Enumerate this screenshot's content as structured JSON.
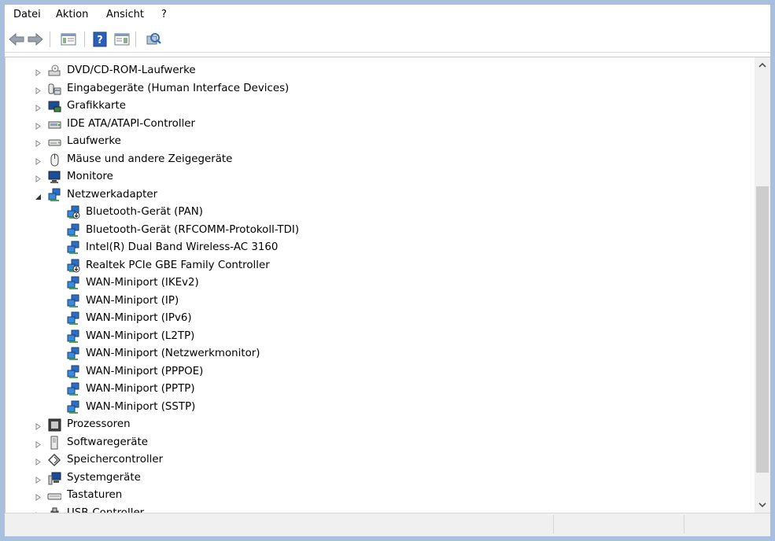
{
  "menu": [
    {
      "label": "Datei",
      "name": "menu-datei"
    },
    {
      "label": "Aktion",
      "name": "menu-aktion"
    },
    {
      "label": "Ansicht",
      "name": "menu-ansicht"
    },
    {
      "label": "?",
      "name": "menu-help"
    }
  ],
  "toolbar": {
    "back_icon": "arrow-left-icon",
    "forward_icon": "arrow-right-icon",
    "console_tree_icon": "console-tree-icon",
    "help_icon": "help-icon",
    "properties_icon": "properties-pane-icon",
    "scan_icon": "scan-hardware-icon"
  },
  "tree": [
    {
      "label": "DVD/CD-ROM-Laufwerke",
      "icon": "dvd-drive-icon",
      "level": 0,
      "expander": "collapsed"
    },
    {
      "label": "Eingabegeräte (Human Interface Devices)",
      "icon": "hid-icon",
      "level": 0,
      "expander": "collapsed"
    },
    {
      "label": "Grafikkarte",
      "icon": "display-adapter-icon",
      "level": 0,
      "expander": "collapsed"
    },
    {
      "label": "IDE ATA/ATAPI-Controller",
      "icon": "ide-controller-icon",
      "level": 0,
      "expander": "collapsed"
    },
    {
      "label": "Laufwerke",
      "icon": "disk-drive-icon",
      "level": 0,
      "expander": "collapsed"
    },
    {
      "label": "Mäuse und andere Zeigegeräte",
      "icon": "mouse-icon",
      "level": 0,
      "expander": "collapsed"
    },
    {
      "label": "Monitore",
      "icon": "monitor-icon",
      "level": 0,
      "expander": "collapsed"
    },
    {
      "label": "Netzwerkadapter",
      "icon": "network-adapter-icon",
      "level": 0,
      "expander": "expanded"
    },
    {
      "label": "Bluetooth-Gerät (PAN)",
      "icon": "network-adapter-down-icon",
      "level": 1,
      "expander": "none"
    },
    {
      "label": "Bluetooth-Gerät (RFCOMM-Protokoll-TDI)",
      "icon": "network-adapter-icon",
      "level": 1,
      "expander": "none"
    },
    {
      "label": "Intel(R) Dual Band Wireless-AC 3160",
      "icon": "network-adapter-icon",
      "level": 1,
      "expander": "none"
    },
    {
      "label": "Realtek PCIe GBE Family Controller",
      "icon": "network-adapter-down-icon",
      "level": 1,
      "expander": "none"
    },
    {
      "label": "WAN-Miniport (IKEv2)",
      "icon": "network-adapter-icon",
      "level": 1,
      "expander": "none"
    },
    {
      "label": "WAN-Miniport (IP)",
      "icon": "network-adapter-icon",
      "level": 1,
      "expander": "none"
    },
    {
      "label": "WAN-Miniport (IPv6)",
      "icon": "network-adapter-icon",
      "level": 1,
      "expander": "none"
    },
    {
      "label": "WAN-Miniport (L2TP)",
      "icon": "network-adapter-icon",
      "level": 1,
      "expander": "none"
    },
    {
      "label": "WAN-Miniport (Netzwerkmonitor)",
      "icon": "network-adapter-icon",
      "level": 1,
      "expander": "none"
    },
    {
      "label": "WAN-Miniport (PPPOE)",
      "icon": "network-adapter-icon",
      "level": 1,
      "expander": "none"
    },
    {
      "label": "WAN-Miniport (PPTP)",
      "icon": "network-adapter-icon",
      "level": 1,
      "expander": "none"
    },
    {
      "label": "WAN-Miniport (SSTP)",
      "icon": "network-adapter-icon",
      "level": 1,
      "expander": "none"
    },
    {
      "label": "Prozessoren",
      "icon": "processor-icon",
      "level": 0,
      "expander": "collapsed"
    },
    {
      "label": "Softwaregeräte",
      "icon": "software-device-icon",
      "level": 0,
      "expander": "collapsed"
    },
    {
      "label": "Speichercontroller",
      "icon": "storage-controller-icon",
      "level": 0,
      "expander": "collapsed"
    },
    {
      "label": "Systemgeräte",
      "icon": "system-device-icon",
      "level": 0,
      "expander": "collapsed"
    },
    {
      "label": "Tastaturen",
      "icon": "keyboard-icon",
      "level": 0,
      "expander": "collapsed"
    },
    {
      "label": "USB-Controller",
      "icon": "usb-controller-icon",
      "level": 0,
      "expander": "collapsed"
    }
  ],
  "colors": {
    "frame": "#a8c0de",
    "scroll_track": "#f0f0f0",
    "scroll_thumb": "#cdcdcd"
  }
}
